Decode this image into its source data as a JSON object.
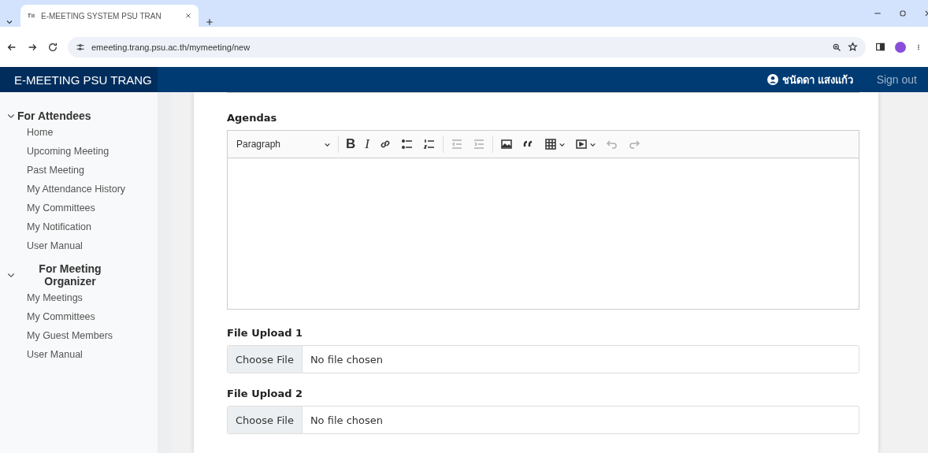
{
  "browser": {
    "tab_title": "E-MEETING SYSTEM PSU TRAN",
    "url": "emeeting.trang.psu.ac.th/mymeeting/new"
  },
  "navbar": {
    "brand": "E-MEETING PSU TRANG",
    "user": "ชนัดดา แสงแก้ว",
    "sign_out": "Sign out"
  },
  "sidebar": [
    {
      "title": "For Attendees",
      "expanded": true,
      "items": [
        "Home",
        "Upcoming Meeting",
        "Past Meeting",
        "My Attendance History",
        "My Committees",
        "My Notification",
        "User Manual"
      ]
    },
    {
      "title": "For Meeting Organizer",
      "expanded": true,
      "items": [
        "My Meetings",
        "My Committees",
        "My Guest Members",
        "User Manual"
      ]
    }
  ],
  "form": {
    "agendas_label": "Agendas",
    "toolbar": [
      {
        "kind": "heading",
        "label": "Paragraph",
        "disabled": false
      },
      {
        "kind": "sep"
      },
      {
        "kind": "bold",
        "label": "B",
        "disabled": false
      },
      {
        "kind": "italic",
        "label": "I",
        "disabled": false
      },
      {
        "kind": "link",
        "disabled": false
      },
      {
        "kind": "bullets",
        "disabled": false
      },
      {
        "kind": "numbers",
        "disabled": false
      },
      {
        "kind": "sep"
      },
      {
        "kind": "outdent",
        "disabled": true
      },
      {
        "kind": "indent",
        "disabled": true
      },
      {
        "kind": "sep"
      },
      {
        "kind": "image",
        "disabled": false
      },
      {
        "kind": "quote",
        "disabled": false
      },
      {
        "kind": "table",
        "disabled": false
      },
      {
        "kind": "media",
        "disabled": false
      },
      {
        "kind": "undo",
        "disabled": true
      },
      {
        "kind": "redo",
        "disabled": true
      }
    ],
    "uploads": [
      {
        "label": "File Upload 1",
        "button": "Choose File",
        "status": "No file chosen"
      },
      {
        "label": "File Upload 2",
        "button": "Choose File",
        "status": "No file chosen"
      }
    ]
  }
}
